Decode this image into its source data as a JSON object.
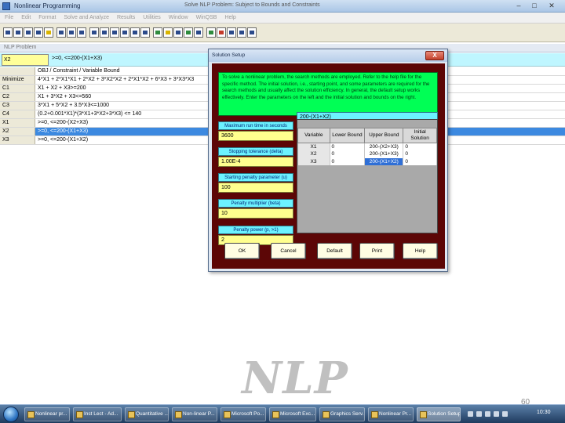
{
  "app": {
    "title": "Nonlinear Programming",
    "center_title": "Solve NLP Problem: Subject to Bounds and Constraints"
  },
  "menu": [
    "File",
    "Edit",
    "Format",
    "Solve and Analyze",
    "Results",
    "Utilities",
    "Window",
    "WinQSB",
    "Help"
  ],
  "subtitle": "NLP Problem",
  "formula_bar": {
    "cell": "X2",
    "formula": ">=0, <=200-(X1+X3)"
  },
  "grid": {
    "header": "OBJ / Constraint / Variable Bound",
    "rows": [
      {
        "name": "Minimize",
        "expr": "4*X1 + 2*X1*X1 + 2*X2 + 3*X2*X2 + 2*X1*X2 + 6*X3 + 3*X3*X3",
        "selected": false
      },
      {
        "name": "C1",
        "expr": "X1 + X2 + X3>=200",
        "selected": false
      },
      {
        "name": "C2",
        "expr": "X1 + 3*X2 + X3<=560",
        "selected": false
      },
      {
        "name": "C3",
        "expr": "3*X1 + 5*X2 + 3.5*X3<=1000",
        "selected": false
      },
      {
        "name": "C4",
        "expr": "(0.2+0.001*X1)*(3*X1+3*X2+3*X3) <= 140",
        "selected": false
      },
      {
        "name": "X1",
        "expr": ">=0, <=200-(X2+X3)",
        "selected": false
      },
      {
        "name": "X2",
        "expr": ">=0, <=200-(X1+X3)",
        "selected": true
      },
      {
        "name": "X3",
        "expr": ">=0, <=200-(X1+X2)",
        "selected": false
      }
    ]
  },
  "dialog": {
    "title": "Solution Setup",
    "close_label": "X",
    "intro": "To solve a nonlinear problem, the search methods are employed. Refer to the help file for the specific method. The initial solution, i.e., starting point, and some parameters are required for the search methods and usually affect the solution efficiency. In general, the default setup works effectively. Enter the parameters on the left and the initial solution and bounds on the right.",
    "params": [
      {
        "label": "Maximum run time in seconds",
        "value": "3600"
      },
      {
        "label": "Stopping tolerance (delta)",
        "value": "1.00E-4"
      },
      {
        "label": "Starting penalty parameter (u)",
        "value": "100"
      },
      {
        "label": "Penalty multiplier (beta)",
        "value": "10"
      },
      {
        "label": "Penalty power (p, >1)",
        "value": "2"
      }
    ],
    "bounds_entry": "200-(X1+X2)",
    "bounds_columns": [
      "Variable",
      "Lower Bound",
      "Upper Bound",
      "Initial Solution"
    ],
    "bounds_rows": [
      {
        "variable": "X1",
        "lower": "0",
        "upper": "200-(X2+X3)",
        "initial": "0"
      },
      {
        "variable": "X2",
        "lower": "0",
        "upper": "200-(X1+X3)",
        "initial": "0"
      },
      {
        "variable": "X3",
        "lower": "0",
        "upper": "200-(X1+X2)",
        "initial": "0"
      }
    ],
    "buttons": {
      "ok": "OK",
      "cancel": "Cancel",
      "default": "Default",
      "print": "Print",
      "help": "Help"
    }
  },
  "watermark": "NLP",
  "slide_number": "60",
  "taskbar": {
    "items": [
      "Nonlinear pr...",
      "Inst Lect - Ad...",
      "Quantitative ...",
      "Non-linear P...",
      "Microsoft Po...",
      "Microsoft Exc...",
      "Graphics Serv...",
      "Nonlinear Pr...",
      "Solution Setup"
    ],
    "time": "10:30"
  },
  "colors": {
    "dialog_body": "#5c0606",
    "intro_bg": "#00ff55",
    "param_label_bg": "#6cf2ff",
    "param_value_bg": "#ffff8e",
    "selection": "#3c89e0"
  }
}
